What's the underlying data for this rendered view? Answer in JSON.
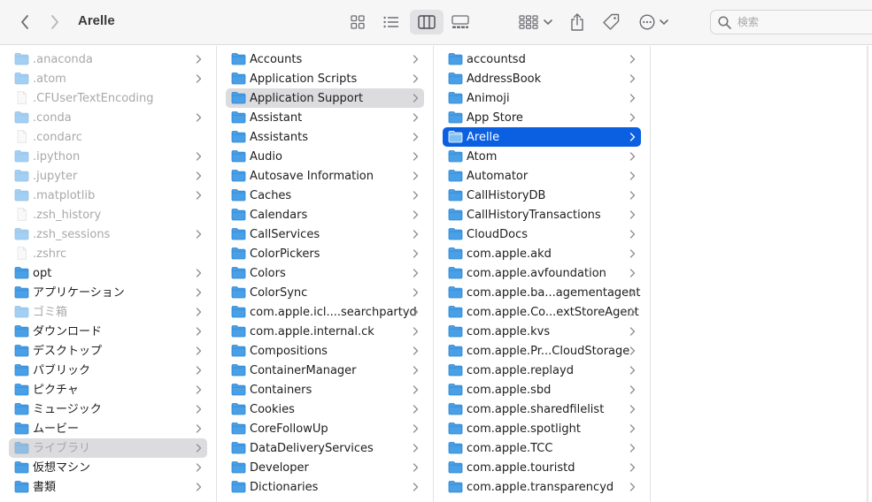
{
  "window": {
    "title": "Arelle"
  },
  "search": {
    "placeholder": "検索"
  },
  "colors": {
    "accent": "#0a60e0",
    "folder": "#4aa0e6",
    "selection_inactive": "#dcdcde"
  },
  "columns": [
    {
      "items": [
        {
          "label": ".anaconda",
          "kind": "folder",
          "hidden": true,
          "chevron": true
        },
        {
          "label": ".atom",
          "kind": "folder",
          "hidden": true,
          "chevron": true
        },
        {
          "label": ".CFUserTextEncoding",
          "kind": "file",
          "hidden": true,
          "chevron": false
        },
        {
          "label": ".conda",
          "kind": "folder",
          "hidden": true,
          "chevron": true
        },
        {
          "label": ".condarc",
          "kind": "file",
          "hidden": true,
          "chevron": false
        },
        {
          "label": ".ipython",
          "kind": "folder",
          "hidden": true,
          "chevron": true
        },
        {
          "label": ".jupyter",
          "kind": "folder",
          "hidden": true,
          "chevron": true
        },
        {
          "label": ".matplotlib",
          "kind": "folder",
          "hidden": true,
          "chevron": true
        },
        {
          "label": ".zsh_history",
          "kind": "file",
          "hidden": true,
          "chevron": false
        },
        {
          "label": ".zsh_sessions",
          "kind": "folder",
          "hidden": true,
          "chevron": true
        },
        {
          "label": ".zshrc",
          "kind": "file",
          "hidden": true,
          "chevron": false
        },
        {
          "label": "opt",
          "kind": "folder",
          "hidden": false,
          "chevron": true
        },
        {
          "label": "アプリケーション",
          "kind": "folder",
          "hidden": false,
          "chevron": true
        },
        {
          "label": "ゴミ箱",
          "kind": "folder",
          "hidden": true,
          "chevron": true
        },
        {
          "label": "ダウンロード",
          "kind": "folder",
          "hidden": false,
          "chevron": true
        },
        {
          "label": "デスクトップ",
          "kind": "folder",
          "hidden": false,
          "chevron": true
        },
        {
          "label": "パブリック",
          "kind": "folder",
          "hidden": false,
          "chevron": true
        },
        {
          "label": "ピクチャ",
          "kind": "folder",
          "hidden": false,
          "chevron": true
        },
        {
          "label": "ミュージック",
          "kind": "folder",
          "hidden": false,
          "chevron": true
        },
        {
          "label": "ムービー",
          "kind": "folder",
          "hidden": false,
          "chevron": true
        },
        {
          "label": "ライブラリ",
          "kind": "folder",
          "hidden": true,
          "chevron": true,
          "selected": "gray"
        },
        {
          "label": "仮想マシン",
          "kind": "folder",
          "hidden": false,
          "chevron": true
        },
        {
          "label": "書類",
          "kind": "folder",
          "hidden": false,
          "chevron": true
        }
      ]
    },
    {
      "items": [
        {
          "label": "Accounts",
          "kind": "folder",
          "chevron": true
        },
        {
          "label": "Application Scripts",
          "kind": "folder",
          "chevron": true
        },
        {
          "label": "Application Support",
          "kind": "folder",
          "chevron": true,
          "selected": "gray"
        },
        {
          "label": "Assistant",
          "kind": "folder",
          "chevron": true
        },
        {
          "label": "Assistants",
          "kind": "folder",
          "chevron": true
        },
        {
          "label": "Audio",
          "kind": "folder",
          "chevron": true
        },
        {
          "label": "Autosave Information",
          "kind": "folder",
          "chevron": true
        },
        {
          "label": "Caches",
          "kind": "folder",
          "chevron": true
        },
        {
          "label": "Calendars",
          "kind": "folder",
          "chevron": true
        },
        {
          "label": "CallServices",
          "kind": "folder",
          "chevron": true
        },
        {
          "label": "ColorPickers",
          "kind": "folder",
          "chevron": true
        },
        {
          "label": "Colors",
          "kind": "folder",
          "chevron": true
        },
        {
          "label": "ColorSync",
          "kind": "folder",
          "chevron": true
        },
        {
          "label": "com.apple.icl....searchpartyd",
          "kind": "folder",
          "chevron": true
        },
        {
          "label": "com.apple.internal.ck",
          "kind": "folder",
          "chevron": true
        },
        {
          "label": "Compositions",
          "kind": "folder",
          "chevron": true
        },
        {
          "label": "ContainerManager",
          "kind": "folder",
          "chevron": true
        },
        {
          "label": "Containers",
          "kind": "folder",
          "chevron": true
        },
        {
          "label": "Cookies",
          "kind": "folder",
          "chevron": true
        },
        {
          "label": "CoreFollowUp",
          "kind": "folder",
          "chevron": true
        },
        {
          "label": "DataDeliveryServices",
          "kind": "folder",
          "chevron": true
        },
        {
          "label": "Developer",
          "kind": "folder",
          "chevron": true
        },
        {
          "label": "Dictionaries",
          "kind": "folder",
          "chevron": true
        }
      ]
    },
    {
      "items": [
        {
          "label": "accountsd",
          "kind": "folder",
          "chevron": true
        },
        {
          "label": "AddressBook",
          "kind": "folder",
          "chevron": true
        },
        {
          "label": "Animoji",
          "kind": "folder",
          "chevron": true
        },
        {
          "label": "App Store",
          "kind": "folder",
          "chevron": true
        },
        {
          "label": "Arelle",
          "kind": "folder",
          "chevron": true,
          "selected": "blue"
        },
        {
          "label": "Atom",
          "kind": "folder",
          "chevron": true
        },
        {
          "label": "Automator",
          "kind": "folder",
          "chevron": true
        },
        {
          "label": "CallHistoryDB",
          "kind": "folder",
          "chevron": true
        },
        {
          "label": "CallHistoryTransactions",
          "kind": "folder",
          "chevron": true
        },
        {
          "label": "CloudDocs",
          "kind": "folder",
          "chevron": true
        },
        {
          "label": "com.apple.akd",
          "kind": "folder",
          "chevron": true
        },
        {
          "label": "com.apple.avfoundation",
          "kind": "folder",
          "chevron": true
        },
        {
          "label": "com.apple.ba...agementagent",
          "kind": "folder",
          "chevron": true
        },
        {
          "label": "com.apple.Co...extStoreAgent",
          "kind": "folder",
          "chevron": true
        },
        {
          "label": "com.apple.kvs",
          "kind": "folder",
          "chevron": true
        },
        {
          "label": "com.apple.Pr...CloudStorage",
          "kind": "folder",
          "chevron": true
        },
        {
          "label": "com.apple.replayd",
          "kind": "folder",
          "chevron": true
        },
        {
          "label": "com.apple.sbd",
          "kind": "folder",
          "chevron": true
        },
        {
          "label": "com.apple.sharedfilelist",
          "kind": "folder",
          "chevron": true
        },
        {
          "label": "com.apple.spotlight",
          "kind": "folder",
          "chevron": true
        },
        {
          "label": "com.apple.TCC",
          "kind": "folder",
          "chevron": true
        },
        {
          "label": "com.apple.touristd",
          "kind": "folder",
          "chevron": true
        },
        {
          "label": "com.apple.transparencyd",
          "kind": "folder",
          "chevron": true
        }
      ]
    },
    {
      "items": []
    }
  ]
}
